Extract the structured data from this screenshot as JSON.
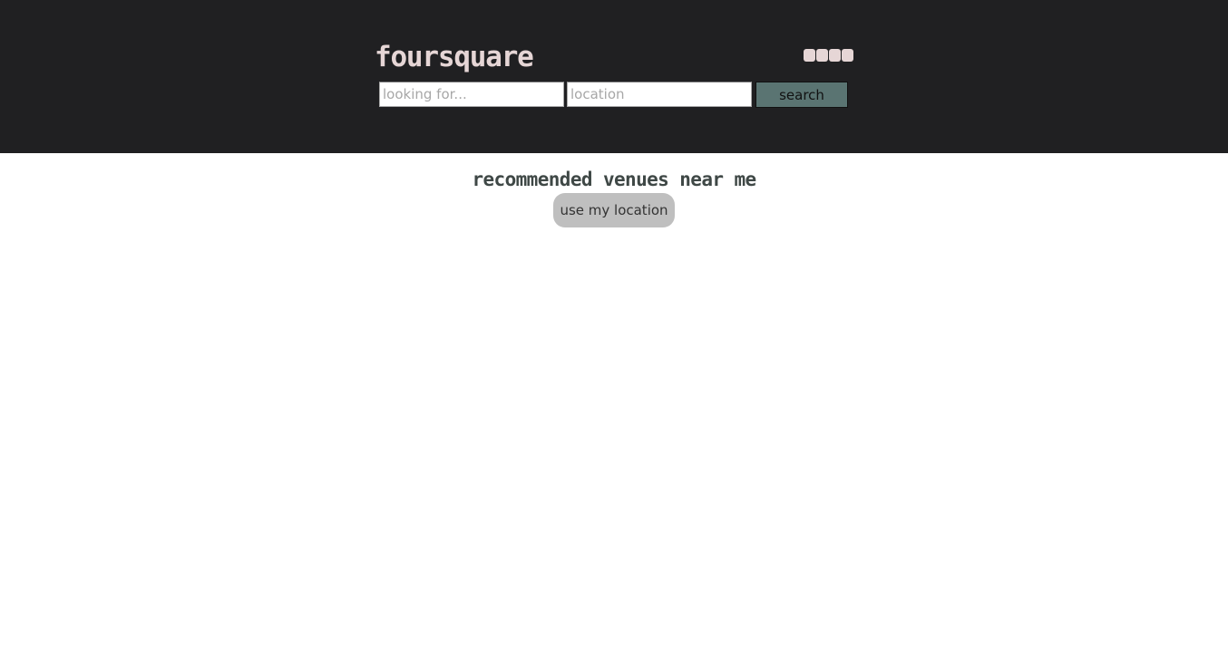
{
  "header": {
    "brand": "foursquare",
    "menu_icon": "grid-menu-icon",
    "search": {
      "looking_placeholder": "looking for...",
      "looking_value": "",
      "location_placeholder": "location",
      "location_value": "",
      "button_label": "search"
    },
    "colors": {
      "background": "#202022",
      "brand_text": "#e6d6d6",
      "search_button": "#5a7472"
    }
  },
  "main": {
    "title": "recommended venues near me",
    "location_button_label": "use my location",
    "colors": {
      "title_text": "#3f4846",
      "location_button": "#bfbfbf"
    }
  }
}
